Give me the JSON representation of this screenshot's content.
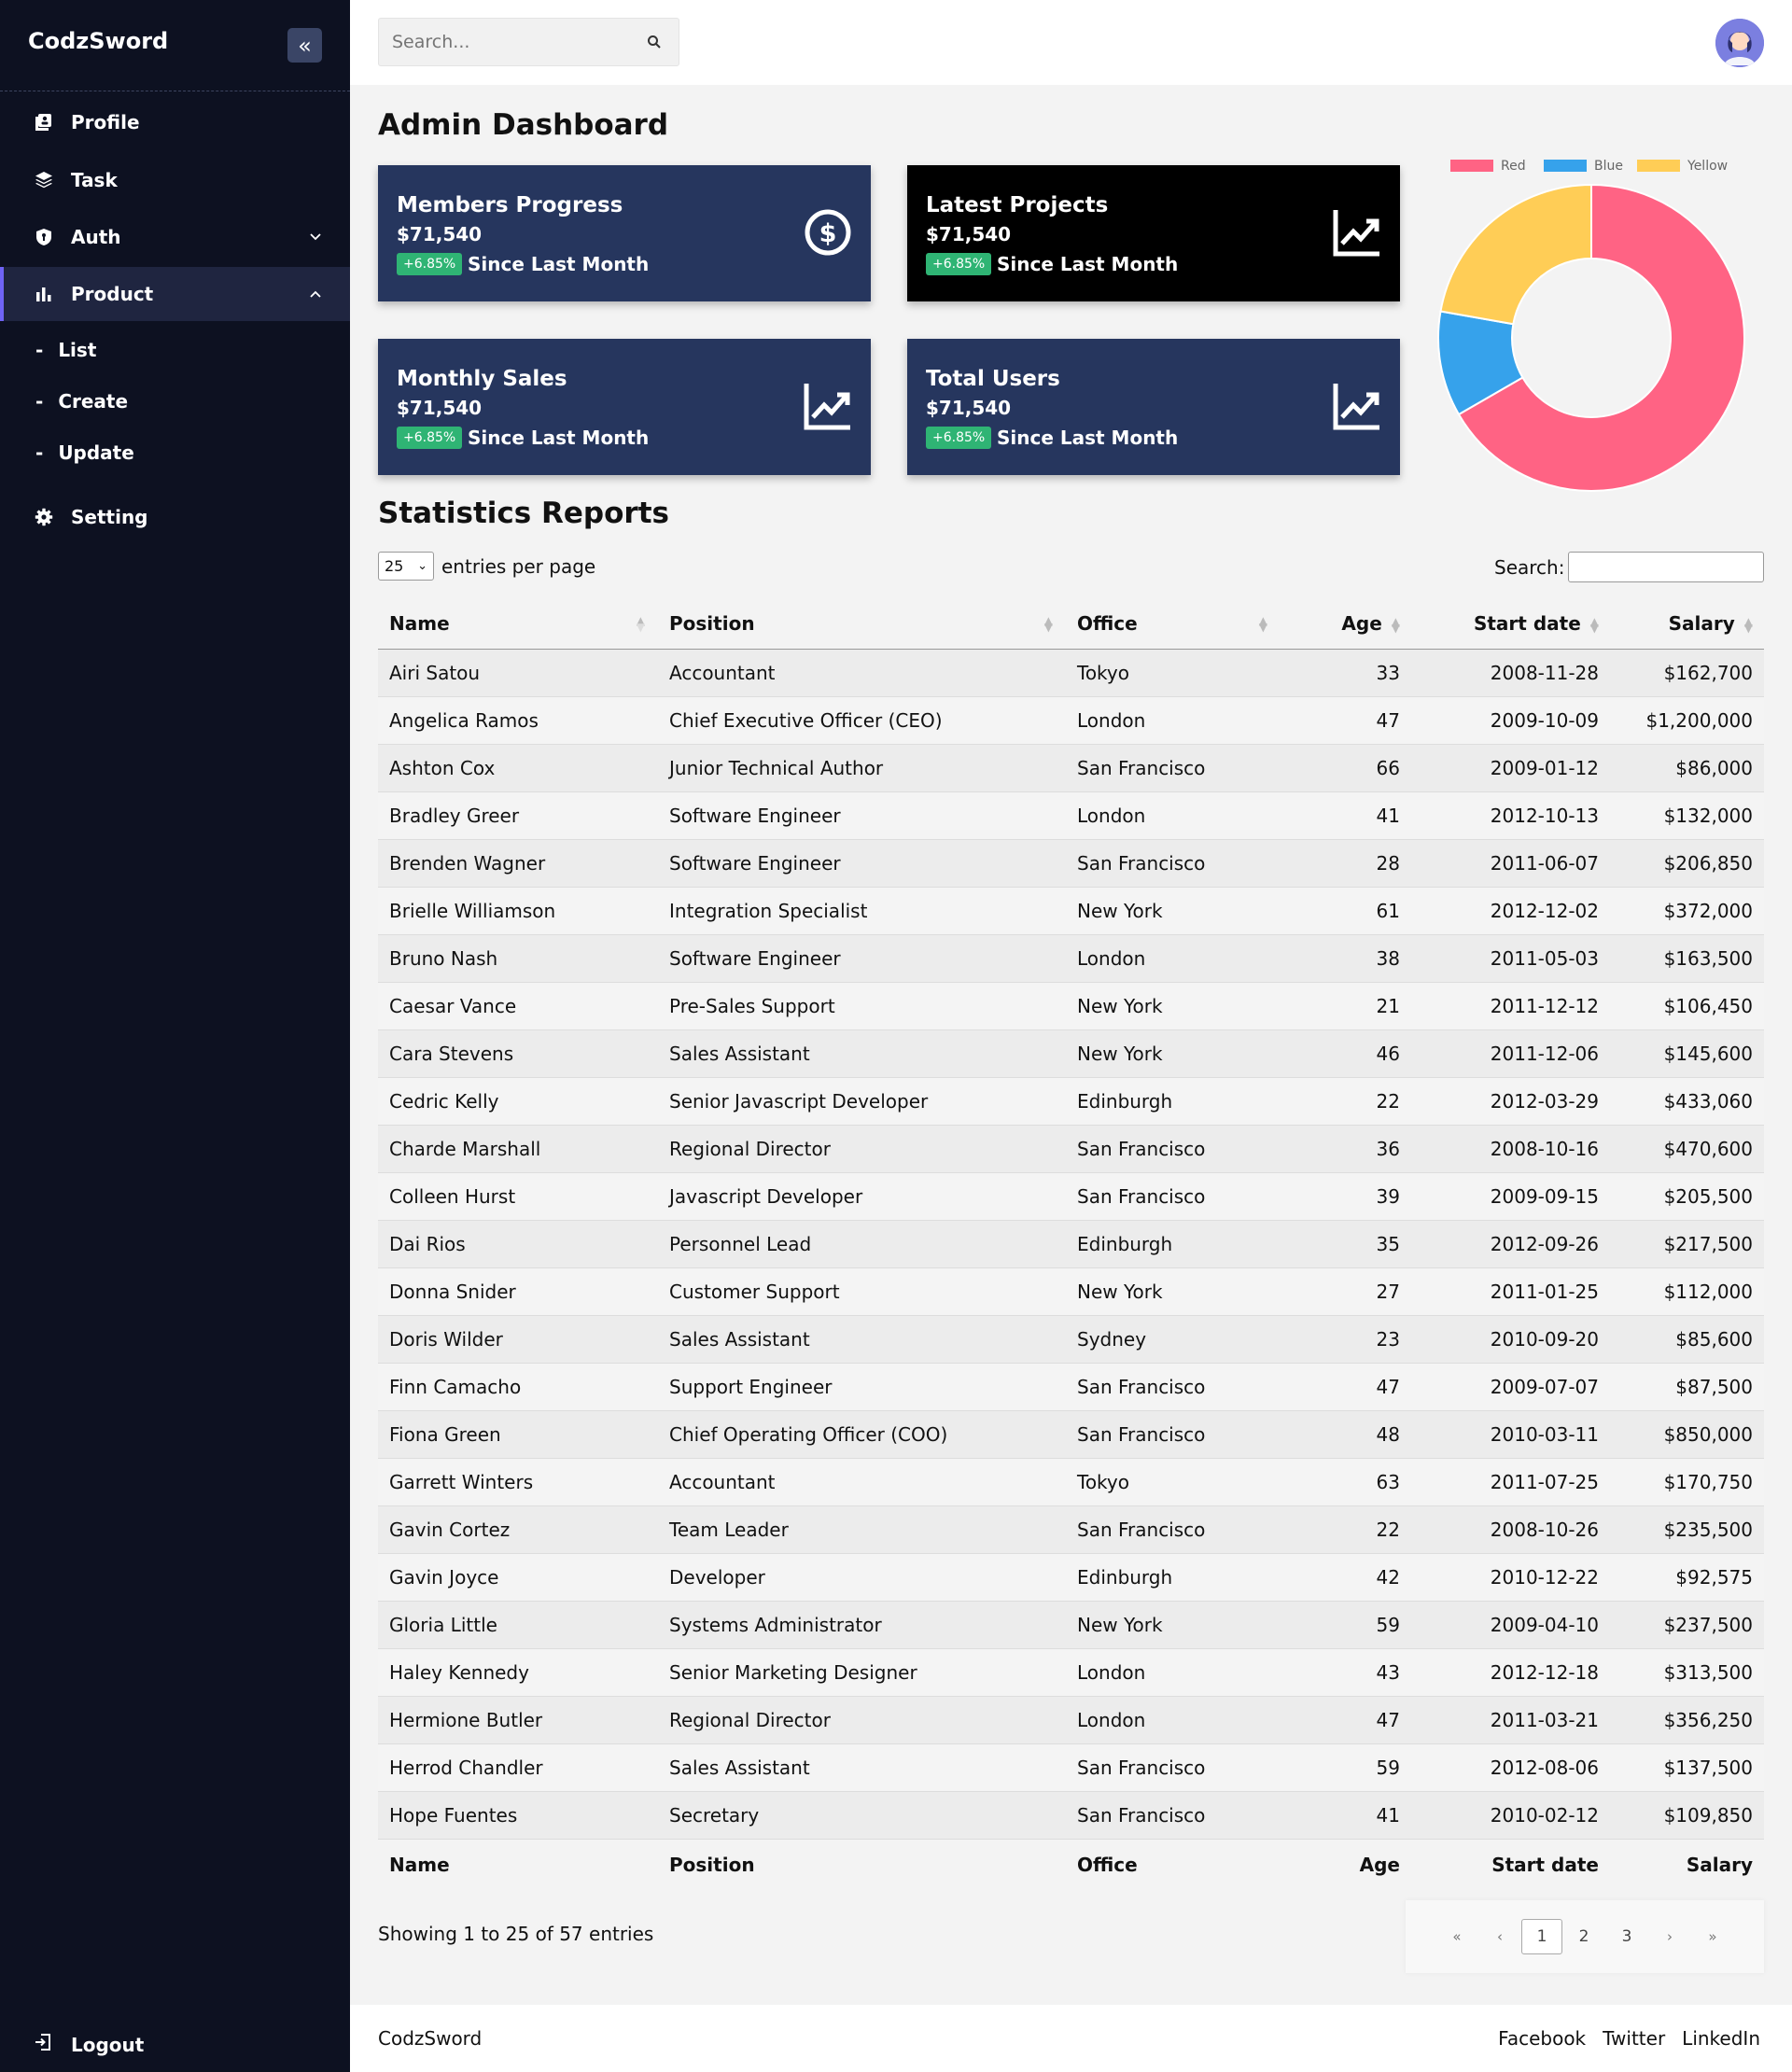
{
  "sidebar": {
    "brand": "CodzSword",
    "items": [
      {
        "label": "Profile"
      },
      {
        "label": "Task"
      },
      {
        "label": "Auth"
      },
      {
        "label": "Product"
      }
    ],
    "subitems": [
      {
        "label": "List"
      },
      {
        "label": "Create"
      },
      {
        "label": "Update"
      }
    ],
    "setting": "Setting",
    "logout": "Logout"
  },
  "header": {
    "search_placeholder": "Search..."
  },
  "page_title": "Admin Dashboard",
  "cards": [
    {
      "title": "Members Progress",
      "value": "$71,540",
      "badge": "+6.85%",
      "since": "Since Last Month",
      "icon": "dollar-circle-icon"
    },
    {
      "title": "Latest Projects",
      "value": "$71,540",
      "badge": "+6.85%",
      "since": "Since Last Month",
      "icon": "chart-line-icon"
    },
    {
      "title": "Monthly Sales",
      "value": "$71,540",
      "badge": "+6.85%",
      "since": "Since Last Month",
      "icon": "chart-line-icon"
    },
    {
      "title": "Total Users",
      "value": "$71,540",
      "badge": "+6.85%",
      "since": "Since Last Month",
      "icon": "chart-line-icon"
    }
  ],
  "chart_data": {
    "type": "pie",
    "donut": true,
    "categories": [
      "Red",
      "Blue",
      "Yellow"
    ],
    "values": [
      300,
      50,
      100
    ],
    "colors": [
      "#ff6384",
      "#36a2eb",
      "#ffcd56"
    ],
    "legend": "top"
  },
  "section_title": "Statistics Reports",
  "table_controls": {
    "per_page": "25",
    "per_page_label": "entries per page",
    "search_label": "Search:"
  },
  "table": {
    "columns": [
      "Name",
      "Position",
      "Office",
      "Age",
      "Start date",
      "Salary"
    ],
    "rows": [
      [
        "Airi Satou",
        "Accountant",
        "Tokyo",
        "33",
        "2008-11-28",
        "$162,700"
      ],
      [
        "Angelica Ramos",
        "Chief Executive Officer (CEO)",
        "London",
        "47",
        "2009-10-09",
        "$1,200,000"
      ],
      [
        "Ashton Cox",
        "Junior Technical Author",
        "San Francisco",
        "66",
        "2009-01-12",
        "$86,000"
      ],
      [
        "Bradley Greer",
        "Software Engineer",
        "London",
        "41",
        "2012-10-13",
        "$132,000"
      ],
      [
        "Brenden Wagner",
        "Software Engineer",
        "San Francisco",
        "28",
        "2011-06-07",
        "$206,850"
      ],
      [
        "Brielle Williamson",
        "Integration Specialist",
        "New York",
        "61",
        "2012-12-02",
        "$372,000"
      ],
      [
        "Bruno Nash",
        "Software Engineer",
        "London",
        "38",
        "2011-05-03",
        "$163,500"
      ],
      [
        "Caesar Vance",
        "Pre-Sales Support",
        "New York",
        "21",
        "2011-12-12",
        "$106,450"
      ],
      [
        "Cara Stevens",
        "Sales Assistant",
        "New York",
        "46",
        "2011-12-06",
        "$145,600"
      ],
      [
        "Cedric Kelly",
        "Senior Javascript Developer",
        "Edinburgh",
        "22",
        "2012-03-29",
        "$433,060"
      ],
      [
        "Charde Marshall",
        "Regional Director",
        "San Francisco",
        "36",
        "2008-10-16",
        "$470,600"
      ],
      [
        "Colleen Hurst",
        "Javascript Developer",
        "San Francisco",
        "39",
        "2009-09-15",
        "$205,500"
      ],
      [
        "Dai Rios",
        "Personnel Lead",
        "Edinburgh",
        "35",
        "2012-09-26",
        "$217,500"
      ],
      [
        "Donna Snider",
        "Customer Support",
        "New York",
        "27",
        "2011-01-25",
        "$112,000"
      ],
      [
        "Doris Wilder",
        "Sales Assistant",
        "Sydney",
        "23",
        "2010-09-20",
        "$85,600"
      ],
      [
        "Finn Camacho",
        "Support Engineer",
        "San Francisco",
        "47",
        "2009-07-07",
        "$87,500"
      ],
      [
        "Fiona Green",
        "Chief Operating Officer (COO)",
        "San Francisco",
        "48",
        "2010-03-11",
        "$850,000"
      ],
      [
        "Garrett Winters",
        "Accountant",
        "Tokyo",
        "63",
        "2011-07-25",
        "$170,750"
      ],
      [
        "Gavin Cortez",
        "Team Leader",
        "San Francisco",
        "22",
        "2008-10-26",
        "$235,500"
      ],
      [
        "Gavin Joyce",
        "Developer",
        "Edinburgh",
        "42",
        "2010-12-22",
        "$92,575"
      ],
      [
        "Gloria Little",
        "Systems Administrator",
        "New York",
        "59",
        "2009-04-10",
        "$237,500"
      ],
      [
        "Haley Kennedy",
        "Senior Marketing Designer",
        "London",
        "43",
        "2012-12-18",
        "$313,500"
      ],
      [
        "Hermione Butler",
        "Regional Director",
        "London",
        "47",
        "2011-03-21",
        "$356,250"
      ],
      [
        "Herrod Chandler",
        "Sales Assistant",
        "San Francisco",
        "59",
        "2012-08-06",
        "$137,500"
      ],
      [
        "Hope Fuentes",
        "Secretary",
        "San Francisco",
        "41",
        "2010-02-12",
        "$109,850"
      ]
    ]
  },
  "pagination": {
    "info": "Showing 1 to 25 of 57 entries",
    "first": "«",
    "prev": "‹",
    "pages": [
      "1",
      "2",
      "3"
    ],
    "next": "›",
    "last": "»"
  },
  "footer": {
    "brand": "CodzSword",
    "links": [
      "Facebook",
      "Twitter",
      "LinkedIn"
    ]
  }
}
